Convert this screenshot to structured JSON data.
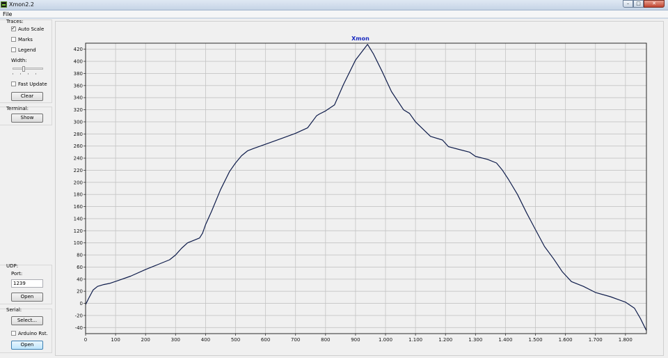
{
  "window": {
    "title": "Xmon2.2",
    "minimize": "–",
    "maximize": "□",
    "close": "✕"
  },
  "menu": {
    "file": "File"
  },
  "sidebar": {
    "traces_label": "Traces:",
    "auto_scale": {
      "label": "Auto Scale",
      "checked": true
    },
    "marks": {
      "label": "Marks",
      "checked": false
    },
    "legend": {
      "label": "Legend",
      "checked": false
    },
    "width_label": "Width:",
    "width_level": 0.35,
    "fast_update": {
      "label": "Fast Update",
      "checked": false
    },
    "clear_button": "Clear",
    "terminal_label": "Terminal:",
    "show_button": "Show",
    "udp_label": "UDP:",
    "port_label": "Port:",
    "port_value": "1239",
    "udp_open_button": "Open",
    "serial_label": "Serial:",
    "select_button": "Select...",
    "arduino_rst": {
      "label": "Arduino Rst.",
      "checked": false
    },
    "serial_open_button": "Open"
  },
  "colors": {
    "trace": "#0d1b4a",
    "title": "#1a2bbf",
    "grid": "#c4c4c4",
    "plot_bg": "#f0f0f0"
  },
  "chart_data": {
    "type": "line",
    "title": "Xmon",
    "xlabel": "",
    "ylabel": "",
    "xlim": [
      0,
      1870
    ],
    "ylim": [
      -50,
      430
    ],
    "grid": true,
    "xticks": [
      0,
      100,
      200,
      300,
      400,
      500,
      600,
      700,
      800,
      900,
      1000,
      1100,
      1200,
      1300,
      1400,
      1500,
      1600,
      1700,
      1800
    ],
    "xtick_labels": [
      "0",
      "100",
      "200",
      "300",
      "400",
      "500",
      "600",
      "700",
      "800",
      "900",
      "1.000",
      "1.100",
      "1.200",
      "1.300",
      "1.400",
      "1.500",
      "1.600",
      "1.700",
      "1.800"
    ],
    "yticks": [
      -40,
      -20,
      0,
      20,
      40,
      60,
      80,
      100,
      120,
      140,
      160,
      180,
      200,
      220,
      240,
      260,
      280,
      300,
      320,
      340,
      360,
      380,
      400,
      420
    ],
    "series": [
      {
        "x": [
          0,
          10,
          25,
          40,
          60,
          80,
          110,
          150,
          200,
          240,
          280,
          300,
          320,
          340,
          360,
          380,
          390,
          400,
          420,
          450,
          480,
          500,
          520,
          540,
          560,
          600,
          650,
          700,
          740,
          770,
          780,
          800,
          830,
          860,
          900,
          940,
          960,
          990,
          1020,
          1060,
          1080,
          1100,
          1150,
          1190,
          1210,
          1240,
          1280,
          1300,
          1340,
          1370,
          1390,
          1410,
          1440,
          1470,
          1500,
          1530,
          1560,
          1590,
          1620,
          1660,
          1700,
          1750,
          1800,
          1830,
          1850,
          1870
        ],
        "y": [
          -2,
          8,
          22,
          28,
          31,
          33,
          38,
          45,
          56,
          64,
          72,
          80,
          91,
          100,
          104,
          108,
          116,
          130,
          152,
          188,
          218,
          232,
          244,
          252,
          256,
          263,
          272,
          281,
          290,
          310,
          313,
          318,
          328,
          362,
          402,
          428,
          412,
          382,
          350,
          320,
          314,
          300,
          276,
          270,
          259,
          255,
          250,
          243,
          238,
          232,
          220,
          205,
          180,
          150,
          122,
          94,
          74,
          52,
          36,
          28,
          18,
          11,
          2,
          -8,
          -25,
          -45
        ]
      }
    ]
  }
}
